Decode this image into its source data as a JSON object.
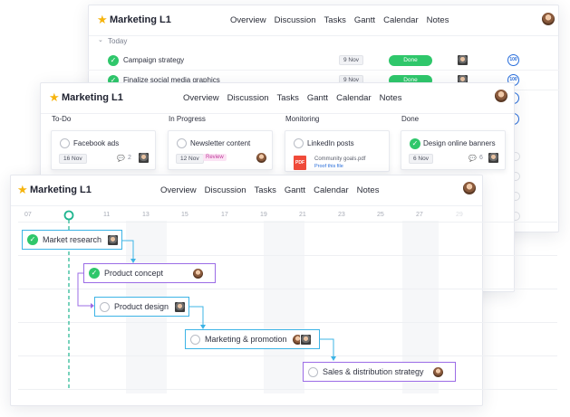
{
  "project_title": "Marketing L1",
  "nav": [
    "Overview",
    "Discussion",
    "Tasks",
    "Gantt",
    "Calendar",
    "Notes"
  ],
  "list_view": {
    "section_label": "Today",
    "rows": [
      {
        "title": "Campaign strategy",
        "date": "9 Nov",
        "status": "Done",
        "count": "100"
      },
      {
        "title": "Finalize social media graphics",
        "date": "9 Nov",
        "status": "Done",
        "count": "100"
      }
    ]
  },
  "board_view": {
    "columns": [
      {
        "name": "To-Do",
        "card": {
          "title": "Facebook ads",
          "date": "16 Nov",
          "comments": "2",
          "done": false
        }
      },
      {
        "name": "In Progress",
        "card": {
          "title": "Newsletter content",
          "date": "12 Nov",
          "tag": "Review",
          "done": false
        }
      },
      {
        "name": "Monitoring",
        "card": {
          "title": "LinkedIn posts",
          "file": "Community goals.pdf",
          "file_action": "Proof this file",
          "file_type": "PDF",
          "done": false
        }
      },
      {
        "name": "Done",
        "card": {
          "title": "Design online banners",
          "date": "6 Nov",
          "comments": "6",
          "done": true
        }
      }
    ]
  },
  "gantt_view": {
    "ticks": [
      "07",
      "09",
      "11",
      "13",
      "15",
      "17",
      "19",
      "21",
      "23",
      "25",
      "27",
      "29"
    ],
    "tasks": [
      {
        "name": "Market research",
        "done": true
      },
      {
        "name": "Product concept",
        "done": true
      },
      {
        "name": "Product design",
        "done": false
      },
      {
        "name": "Marketing & promotion",
        "done": false
      },
      {
        "name": "Sales & distribution strategy",
        "done": false
      }
    ]
  },
  "colors": {
    "accent_green": "#2fc76b",
    "gantt_blue": "#3db4e6",
    "gantt_purple": "#9b6ce6",
    "today_marker": "#1fb58f",
    "star": "#f6b40e"
  }
}
